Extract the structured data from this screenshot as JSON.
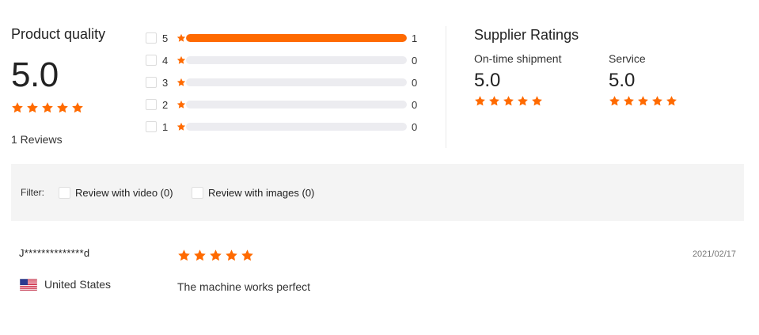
{
  "product_quality": {
    "title": "Product quality",
    "score": "5.0",
    "stars": 5,
    "reviews_label": "1 Reviews"
  },
  "distribution": [
    {
      "stars": "5",
      "count": "1",
      "fraction": 1.0
    },
    {
      "stars": "4",
      "count": "0",
      "fraction": 0
    },
    {
      "stars": "3",
      "count": "0",
      "fraction": 0
    },
    {
      "stars": "2",
      "count": "0",
      "fraction": 0
    },
    {
      "stars": "1",
      "count": "0",
      "fraction": 0
    }
  ],
  "supplier": {
    "title": "Supplier Ratings",
    "shipment": {
      "label": "On-time shipment",
      "score": "5.0",
      "stars": 5
    },
    "service": {
      "label": "Service",
      "score": "5.0",
      "stars": 5
    }
  },
  "filter": {
    "label": "Filter:",
    "options": [
      {
        "label": "Review with video (0)"
      },
      {
        "label": "Review with images (0)"
      }
    ]
  },
  "review": {
    "user": "J**************d",
    "country": "United States",
    "stars": 5,
    "text": "The machine works perfect",
    "date": "2021/02/17"
  },
  "colors": {
    "accent": "#ff6a00",
    "bar_bg": "#ececf0",
    "filter_bg": "#f4f4f4"
  },
  "icons": {
    "star": "star-icon",
    "flag": "us-flag-icon",
    "checkbox": "checkbox-icon"
  }
}
